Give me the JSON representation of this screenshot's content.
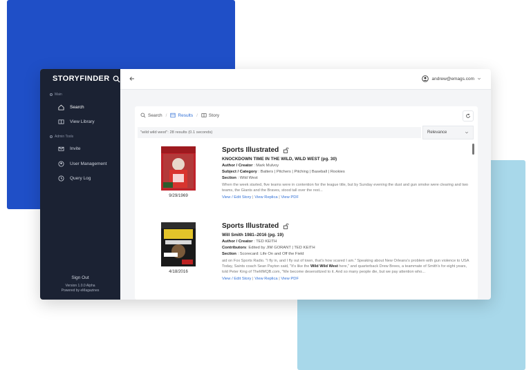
{
  "colors": {
    "sidebar": "#1b2233",
    "accent": "#2f6fd6",
    "deco_blue": "#1f4fc7",
    "deco_light": "#a8d8ea"
  },
  "sidebar": {
    "brand": "STORYFINDER",
    "sections": [
      {
        "label": "Main",
        "items": [
          {
            "label": "Search",
            "icon": "home-icon"
          },
          {
            "label": "View Library",
            "icon": "book-icon"
          }
        ]
      },
      {
        "label": "Admin Tools",
        "items": [
          {
            "label": "Invite",
            "icon": "mail-icon"
          },
          {
            "label": "User Management",
            "icon": "user-icon"
          },
          {
            "label": "Query Log",
            "icon": "clock-icon"
          }
        ]
      }
    ],
    "sign_out": "Sign Out",
    "version": "Version 1.0.0 Alpha",
    "powered_by": "Powered by eMagazines"
  },
  "topbar": {
    "user_email": "andrew@emags.com"
  },
  "breadcrumbs": [
    {
      "label": "Search"
    },
    {
      "label": "Results"
    },
    {
      "label": "Story"
    }
  ],
  "search": {
    "summary": "\"wild wild west\": 28 results (0.1 seconds)"
  },
  "sort": {
    "selected": "Relevance"
  },
  "results": [
    {
      "magazine": "Sports Illustrated",
      "date": "9/29/1969",
      "story": "KNOCKDOWN TIME IN THE WILD, WILD WEST (pg. 30)",
      "author_label": "Author / Creator",
      "author": "Mark Mulvoy",
      "subject_label": "Subject / Category",
      "subject": "Batters | Pitchers | Pitching | Baseball | Rookies",
      "section_label": "Section",
      "section": "Wild West",
      "excerpt": "When the week started, five teams were in contention for the league title, but by Sunday evening the dust and gun smoke were clearing and two teams, the Giants and the Braves, stood tall over the rest...",
      "links": [
        "View / Edit Story",
        "View Replica",
        "View PDF"
      ]
    },
    {
      "magazine": "Sports Illustrated",
      "date": "4/18/2016",
      "story": "Will Smith 1981–2016 (pg. 19)",
      "author_label": "Author / Creator",
      "author": "TED KEITH",
      "contributors_label": "Contributors",
      "contributors": "Edited by JIM GORANT | TED KEITH",
      "section_label": "Section",
      "section": "Scorecard: Life On and Off the Field",
      "excerpt_pre": "aid on Fox Sports Radio. \"I fly in, and I fly out of town, that's how scared I am.\" Speaking about New Orleans's problem with gun violence to USA Today, Saints coach Sean Payton said, \"It's like the ",
      "excerpt_hl": "Wild Wild West",
      "excerpt_post": " here,\" and quarterback Drew Brees, a teammate of Smith's for eight years, told Peter King of TheMMQB.com, \"We become desensitized to it. And so many people die, but we pay attention who...",
      "links": [
        "View / Edit Story",
        "View Replica",
        "View PDF"
      ]
    }
  ]
}
